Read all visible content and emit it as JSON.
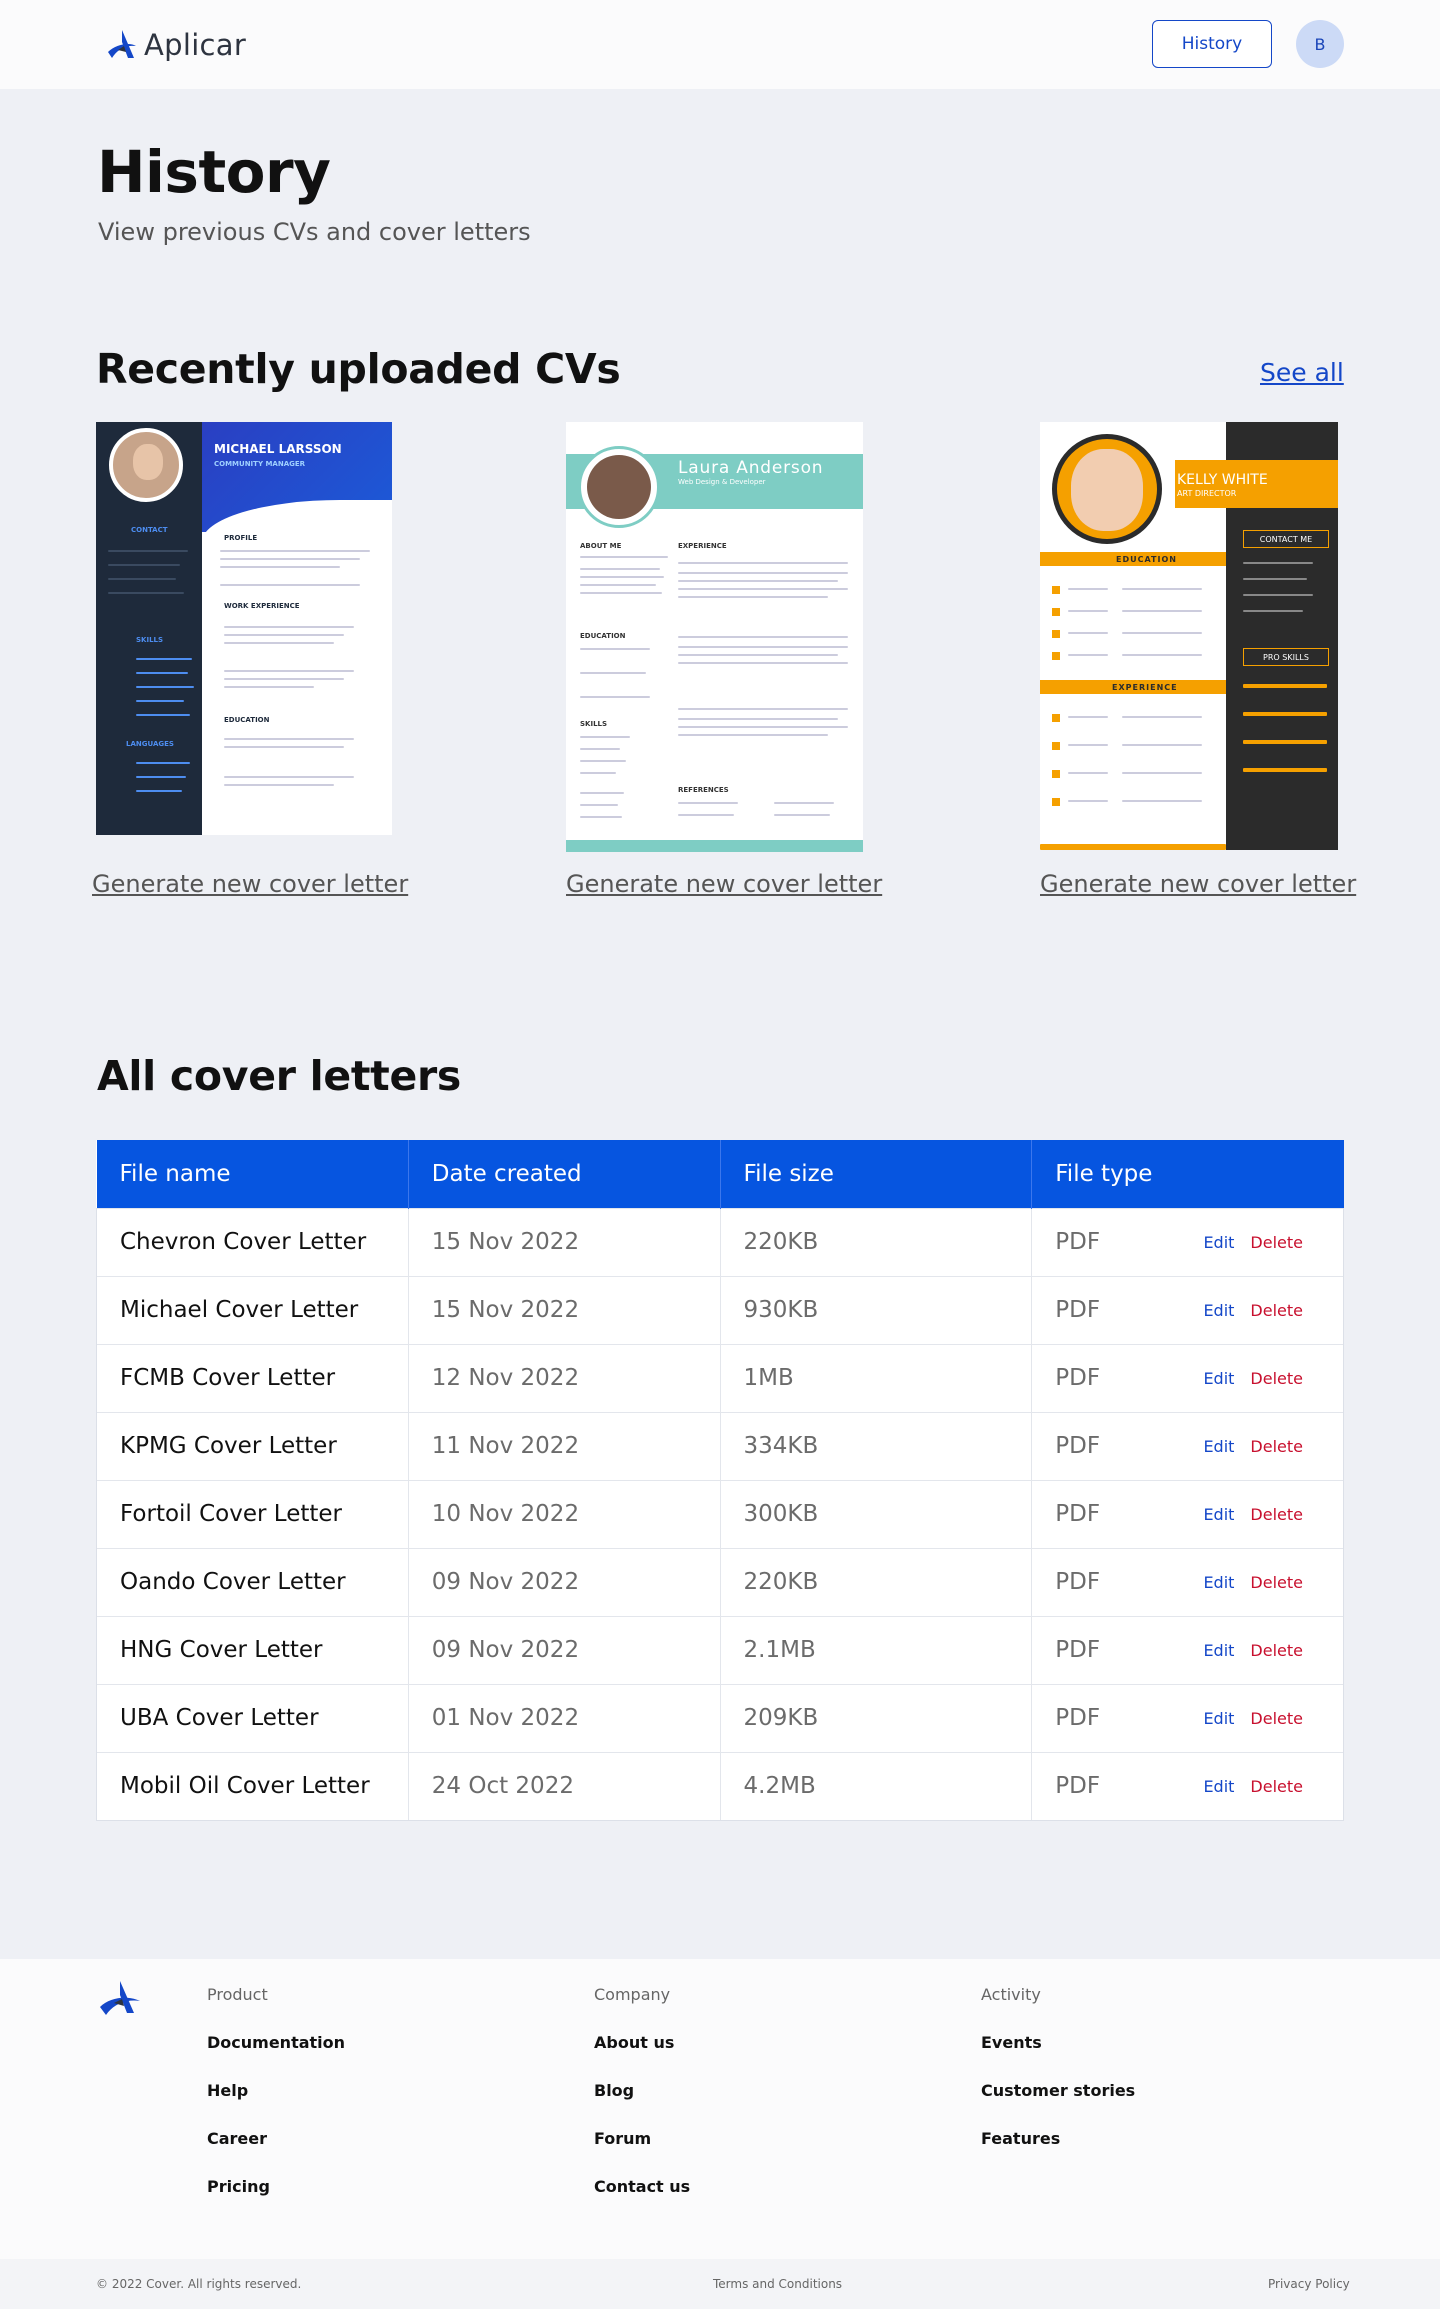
{
  "header": {
    "logo_text": "Aplicar",
    "history_button": "History",
    "avatar_initial": "B"
  },
  "hero": {
    "title": "History",
    "subtitle": "View previous CVs and cover letters"
  },
  "recent_cvs": {
    "title": "Recently uploaded CVs",
    "see_all": "See all",
    "cards": [
      {
        "name": "MICHAEL LARSSON",
        "role": "COMMUNITY MANAGER",
        "sections": [
          "CONTACT",
          "PROFILE",
          "WORK EXPERIENCE",
          "SKILLS",
          "EDUCATION",
          "LANGUAGES"
        ],
        "link": "Generate new cover letter"
      },
      {
        "name": "Laura Anderson",
        "role": "Web Design & Developer",
        "sections": [
          "ABOUT ME",
          "EXPERIENCE",
          "EDUCATION",
          "SKILLS",
          "REFERENCES"
        ],
        "link": "Generate new cover letter"
      },
      {
        "name": "KELLY WHITE",
        "role": "ART DIRECTOR",
        "sections": [
          "EDUCATION",
          "EXPERIENCE",
          "CONTACT ME",
          "PRO SKILLS"
        ],
        "link": "Generate new cover letter"
      }
    ]
  },
  "cover_letters": {
    "title": "All cover letters",
    "columns": [
      "File name",
      "Date created",
      "File size",
      "File type"
    ],
    "edit_label": "Edit",
    "delete_label": "Delete",
    "rows": [
      {
        "name": "Chevron Cover  Letter",
        "date": "15 Nov 2022",
        "size": "220KB",
        "type": "PDF"
      },
      {
        "name": "Michael  Cover Letter",
        "date": "15 Nov 2022",
        "size": "930KB",
        "type": "PDF"
      },
      {
        "name": "FCMB Cover Letter",
        "date": "12 Nov 2022",
        "size": "1MB",
        "type": "PDF"
      },
      {
        "name": "KPMG Cover Letter",
        "date": "11 Nov 2022",
        "size": "334KB",
        "type": "PDF"
      },
      {
        "name": "Fortoil Cover Letter",
        "date": "10 Nov 2022",
        "size": "300KB",
        "type": "PDF"
      },
      {
        "name": "Oando Cover Letter",
        "date": "09  Nov 2022",
        "size": "220KB",
        "type": "PDF"
      },
      {
        "name": "HNG Cover Letter",
        "date": "09 Nov 2022",
        "size": "2.1MB",
        "type": "PDF"
      },
      {
        "name": "UBA  Cover Letter",
        "date": "01 Nov 2022",
        "size": "209KB",
        "type": "PDF"
      },
      {
        "name": "Mobil Oil  Cover Letter",
        "date": "24 Oct 2022",
        "size": "4.2MB",
        "type": "PDF"
      }
    ]
  },
  "footer": {
    "columns": [
      {
        "title": "Product",
        "links": [
          "Documentation",
          "Help",
          "Career",
          "Pricing"
        ]
      },
      {
        "title": "Company",
        "links": [
          "About us",
          "Blog",
          "Forum",
          "Contact us"
        ]
      },
      {
        "title": "Activity",
        "links": [
          "Events",
          "Customer stories",
          "Features"
        ]
      }
    ],
    "copyright": "© 2022 Cover. All rights reserved.",
    "terms": "Terms and Conditions",
    "privacy": "Privacy Policy"
  },
  "colors": {
    "primary": "#0655E0",
    "link": "#1447C8",
    "danger": "#C8102E",
    "background": "#EEF0F5"
  }
}
